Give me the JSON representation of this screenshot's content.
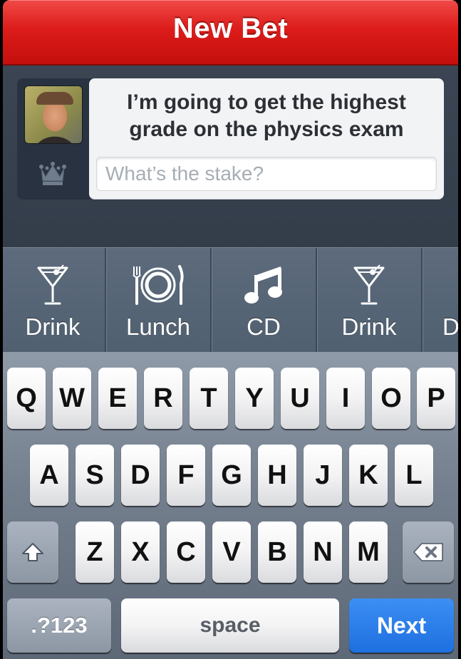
{
  "header": {
    "title": "New Bet"
  },
  "bet": {
    "description": "I’m going to get the highest grade on the physics exam",
    "stake_placeholder": "What’s the stake?",
    "stake_value": ""
  },
  "stake_options": [
    {
      "label": "Drink",
      "icon": "martini-glass-icon"
    },
    {
      "label": "Lunch",
      "icon": "plate-fork-knife-icon"
    },
    {
      "label": "CD",
      "icon": "music-note-icon"
    },
    {
      "label": "Drink",
      "icon": "martini-glass-icon"
    },
    {
      "label": "D",
      "icon": "martini-glass-icon"
    }
  ],
  "keyboard": {
    "row1": [
      "Q",
      "W",
      "E",
      "R",
      "T",
      "Y",
      "U",
      "I",
      "O",
      "P"
    ],
    "row2": [
      "A",
      "S",
      "D",
      "F",
      "G",
      "H",
      "J",
      "K",
      "L"
    ],
    "row3": [
      "Z",
      "X",
      "C",
      "V",
      "B",
      "N",
      "M"
    ],
    "numbers_label": ".?123",
    "space_label": "space",
    "next_label": "Next"
  },
  "colors": {
    "title_bar": "#dc1c1a",
    "background": "#2d3744",
    "next_key": "#1e6fe0"
  }
}
